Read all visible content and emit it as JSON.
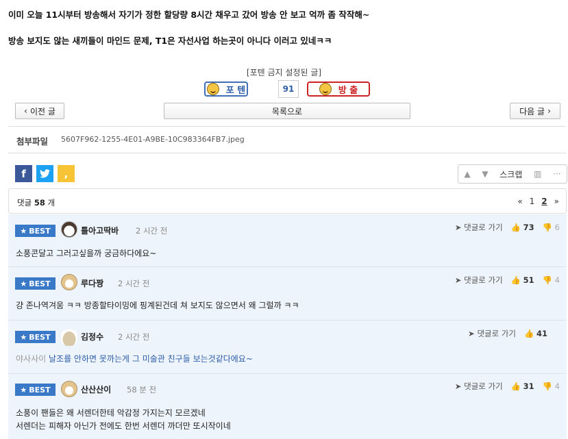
{
  "post": {
    "line1": "이미 오늘 11시부터 방송해서 자기가 정한 할당량 8시간 채우고 갔어 방송 안 보고 억까 좀 작작해~",
    "line2": "방송 보지도 않는 새끼들이 마인드 문제, T1은 자선사업 하는곳이 아니다 이러고 있네ㅋㅋ"
  },
  "vote": {
    "caption": "[포텐 금지 설정된 글]",
    "up_label": "포 텐",
    "count": "91",
    "down_label": "방 출"
  },
  "nav": {
    "prev": "이전 글",
    "list": "목록으로",
    "next": "다음 글"
  },
  "attachment": {
    "label": "첨부파일",
    "file": "5607F962-1255-4E01-A9BE-10C983364FB7.jpeg"
  },
  "tools": {
    "scrap": "스크랩"
  },
  "comments_bar": {
    "prefix": "댓글",
    "count": "58",
    "suffix": "개",
    "pages": [
      "1",
      "2"
    ],
    "current_page": "2"
  },
  "comments": [
    {
      "badge": "BEST",
      "nick": "틀아고딱바",
      "time": "2 시간 전",
      "reply": "댓글로 가기",
      "up": "73",
      "down": "6",
      "text": "소풍콘달고 그러고싶을까 궁금하다에요~"
    },
    {
      "badge": "BEST",
      "nick": "루다짱",
      "time": "2 시간 전",
      "reply": "댓글로 가기",
      "up": "51",
      "down": "4",
      "text": "걍 존나역겨움 ㅋㅋ 방종할타이밍에 핑계된건데 쳐 보지도 않으면서 왜 그럴까 ㅋㅋ"
    },
    {
      "badge": "BEST",
      "nick": "김정수",
      "time": "2 시간 전",
      "reply": "댓글로 가기",
      "up": "41",
      "down": "",
      "text_sub": "야사사이",
      "text": "날조를 안하면 못까는게 그 미술관 친구들 보는것같다에요~"
    },
    {
      "badge": "BEST",
      "nick": "산산산이",
      "time": "58 분 전",
      "reply": "댓글로 가기",
      "up": "31",
      "down": "4",
      "text": "소풍이 팬들은 왜 서렌더한테 악감정 가지는지 모르겠네",
      "text2": "서렌더는 피해자 아닌가 전에도 한번 서렌더 까더만 또시작이네"
    }
  ]
}
